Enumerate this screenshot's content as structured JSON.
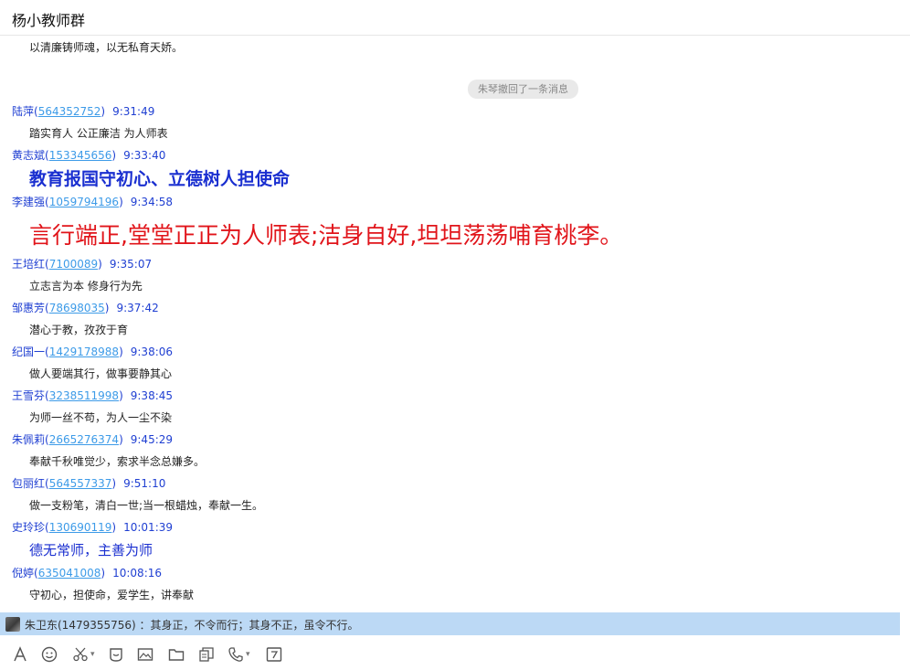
{
  "window": {
    "title": "杨小教师群"
  },
  "recall_notice": "朱琴撤回了一条消息",
  "intro_message": "以清廉铸师魂，以无私育天娇。",
  "messages": [
    {
      "name": "陆萍",
      "qq": "564352752",
      "time": "9:31:49",
      "text": "踏实育人 公正廉洁 为人师表"
    },
    {
      "name": "黄志斌",
      "qq": "153345656",
      "time": "9:33:40",
      "text": "教育报国守初心、立德树人担使命"
    },
    {
      "name": "李建强",
      "qq": "1059794196",
      "time": "9:34:58",
      "text": "言行端正,堂堂正正为人师表;洁身自好,坦坦荡荡哺育桃李。"
    },
    {
      "name": "王培红",
      "qq": "7100089",
      "time": "9:35:07",
      "text": "立志言为本 修身行为先"
    },
    {
      "name": "邹惠芳",
      "qq": "78698035",
      "time": "9:37:42",
      "text": "潜心于教，孜孜于育"
    },
    {
      "name": "纪国一",
      "qq": "1429178988",
      "time": "9:38:06",
      "text": "做人要端其行，做事要静其心"
    },
    {
      "name": "王雪芬",
      "qq": "3238511998",
      "time": "9:38:45",
      "text": "为师一丝不苟，为人一尘不染"
    },
    {
      "name": "朱佩莉",
      "qq": "2665276374",
      "time": "9:45:29",
      "text": "奉献千秋唯觉少，索求半念总嫌多。"
    },
    {
      "name": "包丽红",
      "qq": "564557337",
      "time": "9:51:10",
      "text": "做一支粉笔，清白一世;当一根蜡烛，奉献一生。"
    },
    {
      "name": "史玲珍",
      "qq": "130690119",
      "time": "10:01:39",
      "text": "德无常师，主善为师"
    },
    {
      "name": "倪婷",
      "qq": "635041008",
      "time": "10:08:16",
      "text": "守初心，担使命，爱学生，讲奉献"
    }
  ],
  "latest_notice": "朱卫东(1479355756) ：其身正，不令而行；其身不正，虽令不行。",
  "toolbar": {
    "icons": [
      "font-icon",
      "emoji-icon",
      "scissors-icon",
      "shake-icon",
      "image-icon",
      "folder-icon",
      "collection-icon",
      "phone-icon",
      "screenshot-icon"
    ]
  }
}
